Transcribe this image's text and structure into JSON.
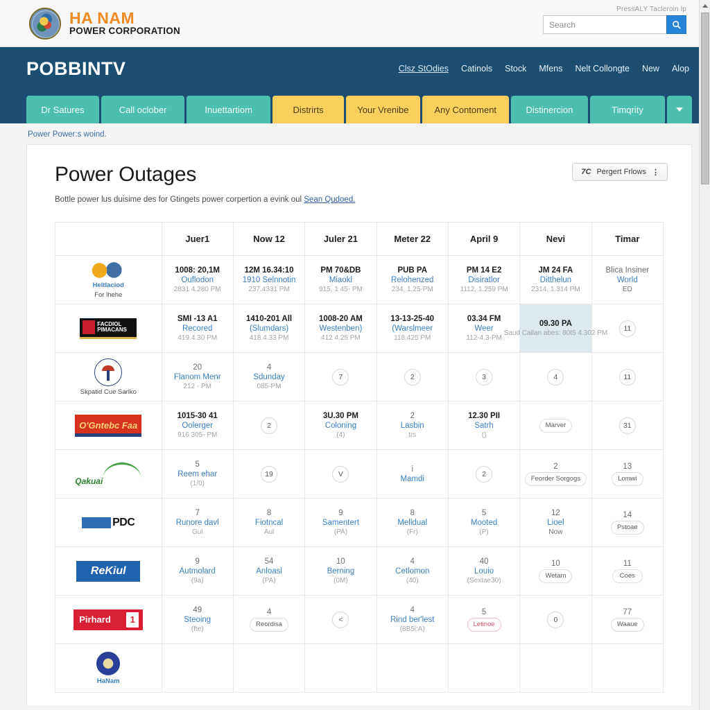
{
  "brand": {
    "line1": "HA NAM",
    "line2": "POWER CORPORATION"
  },
  "topbar": {
    "tip": "PressALY Tacleroin lp",
    "search_placeholder": "Search",
    "search_value": "",
    "search_icon": "search-icon"
  },
  "nav": {
    "site_title": "POBBINTV",
    "links": [
      {
        "label": "Clsz StOdies",
        "active": true
      },
      {
        "label": "Catinols",
        "active": false
      },
      {
        "label": "Stock",
        "active": false
      },
      {
        "label": "Mfens",
        "active": false
      },
      {
        "label": "Nelt Collongte",
        "active": false
      },
      {
        "label": "New",
        "active": false
      },
      {
        "label": "Alop",
        "active": false
      }
    ],
    "tabs": [
      {
        "label": "Dr Satures",
        "style": "teal"
      },
      {
        "label": "Call oclober",
        "style": "teal"
      },
      {
        "label": "Inuettartiom",
        "style": "teal"
      },
      {
        "label": "Distrirts",
        "style": "amber"
      },
      {
        "label": "Your Vrenibe",
        "style": "amber"
      },
      {
        "label": "Any Contoment",
        "style": "amber"
      },
      {
        "label": "Distinercion",
        "style": "teal"
      },
      {
        "label": "Timqrity",
        "style": "teal"
      }
    ],
    "tab_caret_icon": "chevron-down-icon"
  },
  "breadcrumb": "Power Power:s woind.",
  "main": {
    "title": "Power Outages",
    "subtitle_before": "Bottle power lus duisime des for Gtingets power corpertion a evink oul ",
    "subtitle_link": "Sean Qudoed.",
    "filter_button": {
      "kicker": "7C",
      "label": "Pergert Frlows",
      "kebab_icon": "kebab-menu-icon"
    },
    "table": {
      "columns": [
        "",
        "Juer1",
        "Now 12",
        "Juler 21",
        "Meter 22",
        "April 9",
        "Nevi",
        "Timar"
      ],
      "rows": [
        {
          "logo": {
            "kind": "sun",
            "caption": "Heltlaciod",
            "caption2": "For lhehe"
          },
          "cells": [
            {
              "l1": "1008: 20,1M",
              "l2": "Ouflodon",
              "l3": "2831 4.280 PM"
            },
            {
              "l1": "12M 16.34:10",
              "l2": "1910 Selnnotin",
              "l3": "237.4331 PM"
            },
            {
              "l1": "PM 70&DB",
              "l2": "Miaokl",
              "l3": "915, 1 45- PM"
            },
            {
              "l1": "PUB PA",
              "l2": "Relohenzed",
              "l3": "234, 1.25-PM"
            },
            {
              "l1": "PM 14 E2",
              "l2": "Disiratlor",
              "l3": "1112, 1.259 PM"
            },
            {
              "l1": "JM 24 FA",
              "l2": "Ditthelun",
              "l3": "2314, 1.314 PM"
            },
            {
              "l1": "Blica Insiner",
              "l1_plain": true,
              "l2": "World",
              "l3": "ED",
              "l3_dark": true
            }
          ]
        },
        {
          "logo": {
            "kind": "black",
            "text1": "FACDIOL",
            "text2": "PIMACANS"
          },
          "cells": [
            {
              "l1": "SMI -13 A1",
              "l2": "Recored",
              "l3": "419.4.30 PM"
            },
            {
              "l1": "1410-201 All",
              "l2": "(Slumdars)",
              "l3": "418.4.33 PM"
            },
            {
              "l1": "1008-20 AM",
              "l2": "Westenben)",
              "l3": "412 4.25 PM"
            },
            {
              "l1": "13-13-25-40",
              "l2": "(Warslmeer",
              "l3": "118.425 PM"
            },
            {
              "l1": "03.34 FM",
              "l2": "Weer",
              "l3": "112-4.3-PM"
            },
            {
              "l1": "09.30 PA",
              "l3": "Saud Callan abes: 80t5 4.302 PM",
              "highlight": true
            },
            {
              "badge": "circle",
              "badge_text": "11"
            }
          ]
        },
        {
          "logo": {
            "kind": "round",
            "caption": "Skpatid Cue Sarlko",
            "caption_grey": true
          },
          "cells": [
            {
              "l1": "20",
              "l1_plain": true,
              "l2": "Flanom Menr",
              "l3": "212 - PM"
            },
            {
              "l1": "4",
              "l1_plain": true,
              "l2": "Sdunday",
              "l3": "085-PM"
            },
            {
              "badge": "circle",
              "badge_text": "7"
            },
            {
              "badge": "circle",
              "badge_text": "2"
            },
            {
              "badge": "circle",
              "badge_text": "3"
            },
            {
              "badge": "circle",
              "badge_text": "4"
            },
            {
              "badge": "circle",
              "badge_text": "11"
            }
          ]
        },
        {
          "logo": {
            "kind": "red",
            "text": "O'Gntebc Faa"
          },
          "cells": [
            {
              "l1": "1015-30 41",
              "l2": "Oolerger",
              "l3": "916 305- PM"
            },
            {
              "badge": "circle",
              "badge_text": "2"
            },
            {
              "l1": "3U.30 PM",
              "l2": "Coloning",
              "l3": "(4)"
            },
            {
              "l1": "2",
              "l1_plain": true,
              "l2": "Lasbin",
              "l3": "trs"
            },
            {
              "l1": "12.30 PII",
              "l2": "Satrh",
              "l3": "()"
            },
            {
              "badge": "pill",
              "badge_text": "Marver"
            },
            {
              "badge": "circle",
              "badge_text": "31"
            }
          ]
        },
        {
          "logo": {
            "kind": "green",
            "text": "Qakuai"
          },
          "cells": [
            {
              "l1": "5",
              "l1_plain": true,
              "l2": "Reem ehar",
              "l3": "(1/0)"
            },
            {
              "badge": "circle",
              "badge_text": "19"
            },
            {
              "badge": "circle",
              "badge_text": "V"
            },
            {
              "l1": "i",
              "l1_plain": true,
              "l2": "Mamdi",
              "l3": ""
            },
            {
              "badge": "circle",
              "badge_text": "2"
            },
            {
              "l1": "2",
              "l1_plain": true,
              "badge": "pill",
              "badge_text": "Feorder Sorgogs"
            },
            {
              "l1": "13",
              "l1_plain": true,
              "badge": "pill",
              "badge_text": "Lomwi"
            }
          ]
        },
        {
          "logo": {
            "kind": "pdc",
            "text": "PDC"
          },
          "cells": [
            {
              "l1": "7",
              "l1_plain": true,
              "l2": "Runore davl",
              "l3": "Gul"
            },
            {
              "l1": "8",
              "l1_plain": true,
              "l2": "Fiotncal",
              "l3": "Aul"
            },
            {
              "l1": "9",
              "l1_plain": true,
              "l2": "Samentert",
              "l3": "(PA)"
            },
            {
              "l1": "8",
              "l1_plain": true,
              "l2": "Melldual",
              "l3": "(Fr)"
            },
            {
              "l1": "5",
              "l1_plain": true,
              "l2": "Mooted",
              "l3": "(P)"
            },
            {
              "l1": "12",
              "l1_plain": true,
              "l2": "Lioel",
              "l3": "Now",
              "l3_dark": true
            },
            {
              "l1": "14",
              "l1_plain": true,
              "badge": "pill",
              "badge_text": "Pstoae"
            }
          ]
        },
        {
          "logo": {
            "kind": "blue",
            "text": "ReKiul"
          },
          "cells": [
            {
              "l1": "9",
              "l1_plain": true,
              "l2": "Autmolard",
              "l3": "(9a)"
            },
            {
              "l1": "54",
              "l1_plain": true,
              "l2": "Anloasl",
              "l3": "(PA)"
            },
            {
              "l1": "10",
              "l1_plain": true,
              "l2": "Berning",
              "l3": "(0M)"
            },
            {
              "l1": "4",
              "l1_plain": true,
              "l2": "Cetlomon",
              "l3": "(40)"
            },
            {
              "l1": "40",
              "l1_plain": true,
              "l2": "Louio",
              "l3": "(Sextae30)"
            },
            {
              "l1": "10",
              "l1_plain": true,
              "badge": "pill",
              "badge_text": "Wetam"
            },
            {
              "l1": "11",
              "l1_plain": true,
              "badge": "pill",
              "badge_text": "Coes"
            }
          ]
        },
        {
          "logo": {
            "kind": "crimson",
            "text": "Pirhard",
            "badge": "1"
          },
          "cells": [
            {
              "l1": "49",
              "l1_plain": true,
              "l2": "Steoing",
              "l3": "(fte)"
            },
            {
              "l1": "4",
              "l1_plain": true,
              "badge": "pill",
              "badge_text": "Reordisa"
            },
            {
              "badge": "circle",
              "badge_text": "<"
            },
            {
              "l1": "4",
              "l1_plain": true,
              "l2": "Rind ber'lest",
              "l3": "(8B5l:A)"
            },
            {
              "l1": "5",
              "l1_plain": true,
              "badge": "pill",
              "badge_text": "Letinoe",
              "badge_danger": true
            },
            {
              "badge": "circle",
              "badge_text": "0"
            },
            {
              "l1": "77",
              "l1_plain": true,
              "badge": "pill",
              "badge_text": "Waaue"
            }
          ]
        },
        {
          "logo": {
            "kind": "seal",
            "caption": "HaNam"
          },
          "cells": [
            {},
            {},
            {},
            {},
            {},
            {},
            {}
          ]
        }
      ]
    }
  },
  "scrollbar": {
    "up_icon": "scroll-up-arrow-icon"
  }
}
